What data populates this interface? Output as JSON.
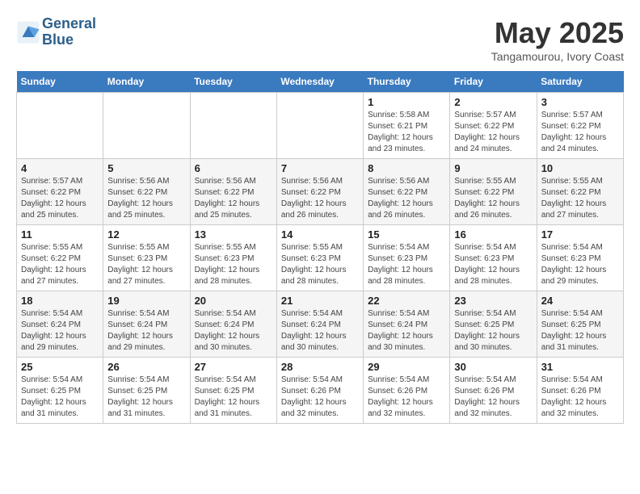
{
  "header": {
    "logo_line1": "General",
    "logo_line2": "Blue",
    "month_title": "May 2025",
    "subtitle": "Tangamourou, Ivory Coast"
  },
  "weekdays": [
    "Sunday",
    "Monday",
    "Tuesday",
    "Wednesday",
    "Thursday",
    "Friday",
    "Saturday"
  ],
  "weeks": [
    [
      {
        "day": "",
        "info": ""
      },
      {
        "day": "",
        "info": ""
      },
      {
        "day": "",
        "info": ""
      },
      {
        "day": "",
        "info": ""
      },
      {
        "day": "1",
        "info": "Sunrise: 5:58 AM\nSunset: 6:21 PM\nDaylight: 12 hours\nand 23 minutes."
      },
      {
        "day": "2",
        "info": "Sunrise: 5:57 AM\nSunset: 6:22 PM\nDaylight: 12 hours\nand 24 minutes."
      },
      {
        "day": "3",
        "info": "Sunrise: 5:57 AM\nSunset: 6:22 PM\nDaylight: 12 hours\nand 24 minutes."
      }
    ],
    [
      {
        "day": "4",
        "info": "Sunrise: 5:57 AM\nSunset: 6:22 PM\nDaylight: 12 hours\nand 25 minutes."
      },
      {
        "day": "5",
        "info": "Sunrise: 5:56 AM\nSunset: 6:22 PM\nDaylight: 12 hours\nand 25 minutes."
      },
      {
        "day": "6",
        "info": "Sunrise: 5:56 AM\nSunset: 6:22 PM\nDaylight: 12 hours\nand 25 minutes."
      },
      {
        "day": "7",
        "info": "Sunrise: 5:56 AM\nSunset: 6:22 PM\nDaylight: 12 hours\nand 26 minutes."
      },
      {
        "day": "8",
        "info": "Sunrise: 5:56 AM\nSunset: 6:22 PM\nDaylight: 12 hours\nand 26 minutes."
      },
      {
        "day": "9",
        "info": "Sunrise: 5:55 AM\nSunset: 6:22 PM\nDaylight: 12 hours\nand 26 minutes."
      },
      {
        "day": "10",
        "info": "Sunrise: 5:55 AM\nSunset: 6:22 PM\nDaylight: 12 hours\nand 27 minutes."
      }
    ],
    [
      {
        "day": "11",
        "info": "Sunrise: 5:55 AM\nSunset: 6:22 PM\nDaylight: 12 hours\nand 27 minutes."
      },
      {
        "day": "12",
        "info": "Sunrise: 5:55 AM\nSunset: 6:23 PM\nDaylight: 12 hours\nand 27 minutes."
      },
      {
        "day": "13",
        "info": "Sunrise: 5:55 AM\nSunset: 6:23 PM\nDaylight: 12 hours\nand 28 minutes."
      },
      {
        "day": "14",
        "info": "Sunrise: 5:55 AM\nSunset: 6:23 PM\nDaylight: 12 hours\nand 28 minutes."
      },
      {
        "day": "15",
        "info": "Sunrise: 5:54 AM\nSunset: 6:23 PM\nDaylight: 12 hours\nand 28 minutes."
      },
      {
        "day": "16",
        "info": "Sunrise: 5:54 AM\nSunset: 6:23 PM\nDaylight: 12 hours\nand 28 minutes."
      },
      {
        "day": "17",
        "info": "Sunrise: 5:54 AM\nSunset: 6:23 PM\nDaylight: 12 hours\nand 29 minutes."
      }
    ],
    [
      {
        "day": "18",
        "info": "Sunrise: 5:54 AM\nSunset: 6:24 PM\nDaylight: 12 hours\nand 29 minutes."
      },
      {
        "day": "19",
        "info": "Sunrise: 5:54 AM\nSunset: 6:24 PM\nDaylight: 12 hours\nand 29 minutes."
      },
      {
        "day": "20",
        "info": "Sunrise: 5:54 AM\nSunset: 6:24 PM\nDaylight: 12 hours\nand 30 minutes."
      },
      {
        "day": "21",
        "info": "Sunrise: 5:54 AM\nSunset: 6:24 PM\nDaylight: 12 hours\nand 30 minutes."
      },
      {
        "day": "22",
        "info": "Sunrise: 5:54 AM\nSunset: 6:24 PM\nDaylight: 12 hours\nand 30 minutes."
      },
      {
        "day": "23",
        "info": "Sunrise: 5:54 AM\nSunset: 6:25 PM\nDaylight: 12 hours\nand 30 minutes."
      },
      {
        "day": "24",
        "info": "Sunrise: 5:54 AM\nSunset: 6:25 PM\nDaylight: 12 hours\nand 31 minutes."
      }
    ],
    [
      {
        "day": "25",
        "info": "Sunrise: 5:54 AM\nSunset: 6:25 PM\nDaylight: 12 hours\nand 31 minutes."
      },
      {
        "day": "26",
        "info": "Sunrise: 5:54 AM\nSunset: 6:25 PM\nDaylight: 12 hours\nand 31 minutes."
      },
      {
        "day": "27",
        "info": "Sunrise: 5:54 AM\nSunset: 6:25 PM\nDaylight: 12 hours\nand 31 minutes."
      },
      {
        "day": "28",
        "info": "Sunrise: 5:54 AM\nSunset: 6:26 PM\nDaylight: 12 hours\nand 32 minutes."
      },
      {
        "day": "29",
        "info": "Sunrise: 5:54 AM\nSunset: 6:26 PM\nDaylight: 12 hours\nand 32 minutes."
      },
      {
        "day": "30",
        "info": "Sunrise: 5:54 AM\nSunset: 6:26 PM\nDaylight: 12 hours\nand 32 minutes."
      },
      {
        "day": "31",
        "info": "Sunrise: 5:54 AM\nSunset: 6:26 PM\nDaylight: 12 hours\nand 32 minutes."
      }
    ]
  ]
}
